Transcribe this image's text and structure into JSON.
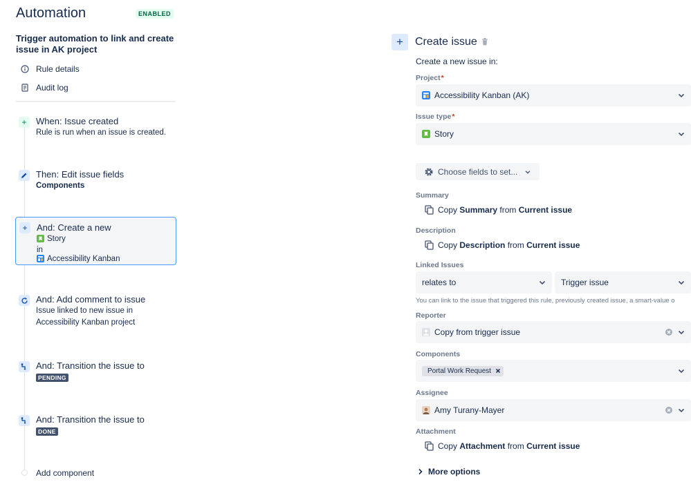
{
  "app": {
    "title": "Automation",
    "status_badge": "ENABLED"
  },
  "rule": {
    "name": "Trigger automation to link and create issue in AK project"
  },
  "nav": [
    {
      "label": "Rule details",
      "icon": "info-icon"
    },
    {
      "label": "Audit log",
      "icon": "document-icon"
    }
  ],
  "steps": {
    "trigger": {
      "title": "When: Issue created",
      "sub": "Rule is run when an issue is created."
    },
    "edit": {
      "title": "Then: Edit issue fields",
      "sub": "Components"
    },
    "create": {
      "title": "And: Create a new",
      "issue_type": "Story",
      "in_label": "in",
      "project": "Accessibility Kanban"
    },
    "comment": {
      "title": "And: Add comment to issue",
      "sub1": "Issue linked to new issue in",
      "sub2": "Accessibility Kanban project"
    },
    "transition1": {
      "title": "And: Transition the issue to",
      "status": "PENDING"
    },
    "transition2": {
      "title": "And: Transition the issue to",
      "status": "DONE"
    },
    "add": {
      "label": "Add component"
    }
  },
  "panel": {
    "title": "Create issue",
    "intro": "Create a new issue in:",
    "project": {
      "label": "Project",
      "required_mark": "*",
      "value": "Accessibility Kanban (AK)"
    },
    "issue_type": {
      "label": "Issue type",
      "required_mark": "*",
      "value": "Story"
    },
    "choose_fields": "Choose fields to set...",
    "summary": {
      "label": "Summary",
      "copy": "Copy",
      "field": "Summary",
      "from": "from",
      "source": "Current issue"
    },
    "description": {
      "label": "Description",
      "copy": "Copy",
      "field": "Description",
      "from": "from",
      "source": "Current issue"
    },
    "linked_issues": {
      "label": "Linked Issues",
      "link_type": "relates to",
      "target": "Trigger issue",
      "helper": "You can link to the issue that triggered this rule, previously created issue, a smart-value o"
    },
    "reporter": {
      "label": "Reporter",
      "value": "Copy from trigger issue"
    },
    "components": {
      "label": "Components",
      "tag": "Portal Work Request"
    },
    "assignee": {
      "label": "Assignee",
      "value": "Amy Turany-Mayer"
    },
    "attachment": {
      "label": "Attachment",
      "copy": "Copy",
      "field": "Attachment",
      "from": "from",
      "source": "Current issue"
    },
    "more_options": "More options"
  },
  "colors": {
    "accent": "#0052cc",
    "story_green": "#65ba43",
    "project_blue": "#2684ff",
    "status_lozenge": "#42526e",
    "enabled_bg": "#e3fcef",
    "enabled_text": "#006644",
    "selected_border": "#4c9aff"
  }
}
